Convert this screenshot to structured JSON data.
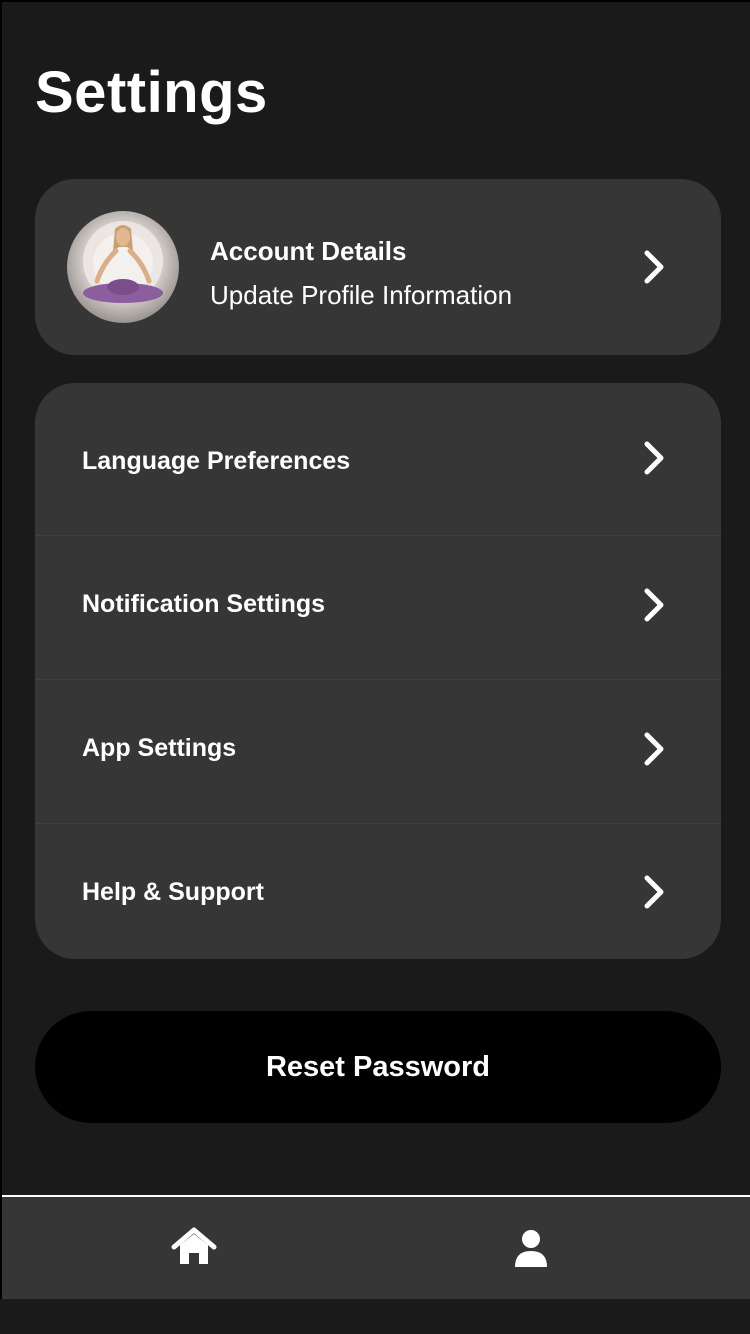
{
  "header": {
    "title": "Settings"
  },
  "account": {
    "title": "Account Details",
    "subtitle": "Update Profile Information",
    "avatar_alt": "profile photo of a woman meditating in lotus pose"
  },
  "menu": {
    "items": [
      {
        "label": "Language Preferences"
      },
      {
        "label": "Notification Settings"
      },
      {
        "label": "App Settings"
      },
      {
        "label": "Help & Support"
      }
    ]
  },
  "actions": {
    "reset_password_label": "Reset Password"
  },
  "tab_bar": {
    "items": [
      {
        "icon": "home-icon",
        "label": ""
      },
      {
        "icon": "user-icon",
        "label": ""
      }
    ]
  },
  "colors": {
    "background": "#1a1a1a",
    "card": "#363636",
    "text": "#ffffff",
    "button": "#000000"
  }
}
